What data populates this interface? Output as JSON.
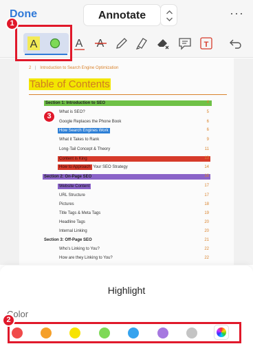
{
  "nav": {
    "done_label": "Done",
    "title": "Annotate",
    "more_label": "···"
  },
  "toolbar": {
    "tools": [
      "highlight-text",
      "highlight-color",
      "underline",
      "strikethrough",
      "pen",
      "marker",
      "eraser",
      "comment",
      "text-box",
      "undo"
    ],
    "highlight_glyph": "A",
    "underline_glyph": "A",
    "strike_glyph": "A",
    "textbox_glyph": "T"
  },
  "markers": {
    "m1": "1",
    "m2": "2",
    "m3": "3"
  },
  "document": {
    "page_number": "2",
    "header_text": "Introduction to Search Engine Optimization",
    "toc_title": "Table of Contents",
    "rows": [
      {
        "label": "Section 1: Introduction to SEO",
        "page": "4",
        "section": true
      },
      {
        "label": "What is SEO?",
        "page": "5"
      },
      {
        "label": "Google Replaces the Phone Book",
        "page": "6"
      },
      {
        "label": "How Search Engines Work",
        "page": "6"
      },
      {
        "label": "What it Takes to Rank",
        "page": "9"
      },
      {
        "label": "Long-Tail Concept & Theory",
        "page": "11"
      },
      {
        "label": "Content is King",
        "page": "13"
      },
      {
        "label_a": "How to Approach",
        "label_b": " Your SEO Strategy",
        "page": "14"
      },
      {
        "label": "Section 2: On-Page SEO",
        "page": "16",
        "section": true
      },
      {
        "label": "Website Content",
        "page": "17"
      },
      {
        "label": "URL Structure",
        "page": "17"
      },
      {
        "label": "Pictures",
        "page": "18"
      },
      {
        "label": "Title Tags & Meta Tags",
        "page": "19"
      },
      {
        "label": "Headline Tags",
        "page": "20"
      },
      {
        "label": "Internal Linking",
        "page": "20"
      },
      {
        "label": "Section 3: Off-Page SEO",
        "page": "21",
        "section": true
      },
      {
        "label": "Who's Linking to You?",
        "page": "22"
      },
      {
        "label": "How are they Linking to You?",
        "page": "22"
      }
    ]
  },
  "sheet": {
    "title": "Highlight",
    "color_label": "Color",
    "colors": [
      "#f04a4a",
      "#f5a02a",
      "#f7e300",
      "#7ed957",
      "#36a3ee",
      "#a678e0",
      "#c4c4c4"
    ]
  },
  "colors": {
    "accent": "#2f79d8",
    "annotation_red": "#e0182a"
  }
}
